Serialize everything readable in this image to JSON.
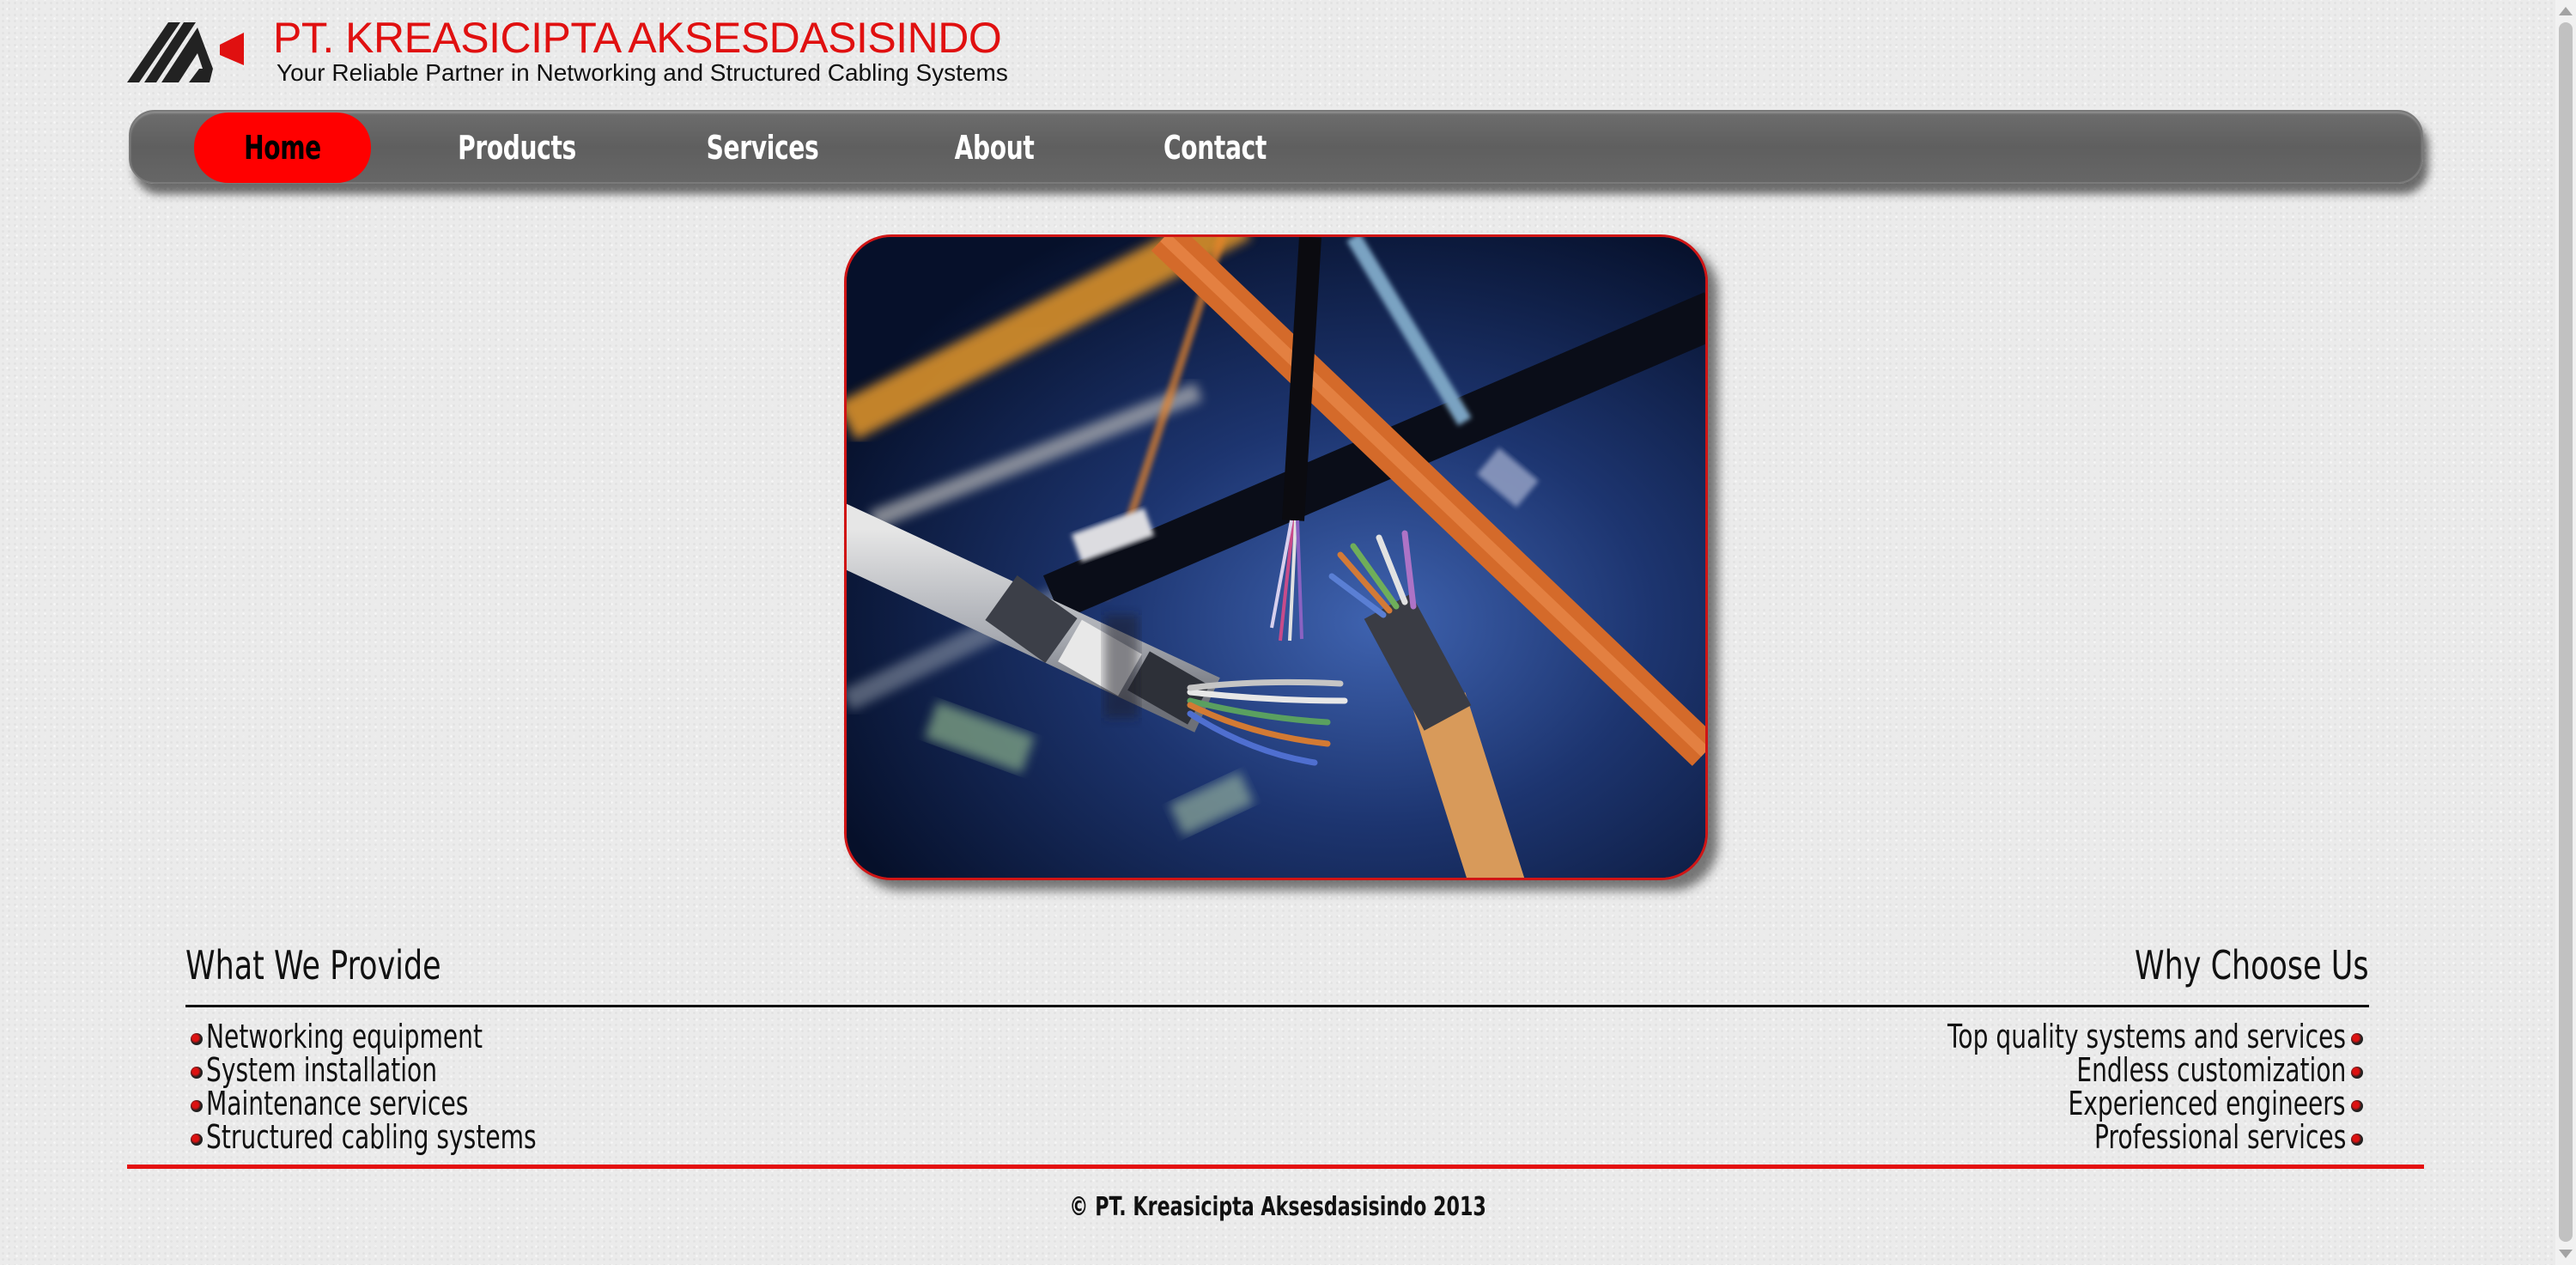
{
  "header": {
    "company_name": "PT. KREASICIPTA AKSESDASISINDO",
    "tagline": "Your Reliable Partner in Networking and Structured Cabling Systems",
    "logo_icon": "company-logo-icon"
  },
  "nav": {
    "items": [
      {
        "label": "Home",
        "active": true
      },
      {
        "label": "Products"
      },
      {
        "label": "Services"
      },
      {
        "label": "About"
      },
      {
        "label": "Contact"
      }
    ]
  },
  "hero": {
    "image": "network-cables-photo"
  },
  "provide": {
    "title": "What We Provide",
    "items": [
      "Networking equipment",
      "System installation",
      "Maintenance services",
      "Structured cabling systems"
    ]
  },
  "why": {
    "title": "Why Choose Us",
    "items": [
      "Top quality systems and services",
      "Endless customization",
      "Experienced engineers",
      "Professional services"
    ]
  },
  "footer": {
    "copyright": "© PT. Kreasicipta Aksesdasisindo 2013"
  },
  "colors": {
    "brand_red": "#e01010",
    "nav_bg": "#666666",
    "active_tab": "#ff0000"
  }
}
